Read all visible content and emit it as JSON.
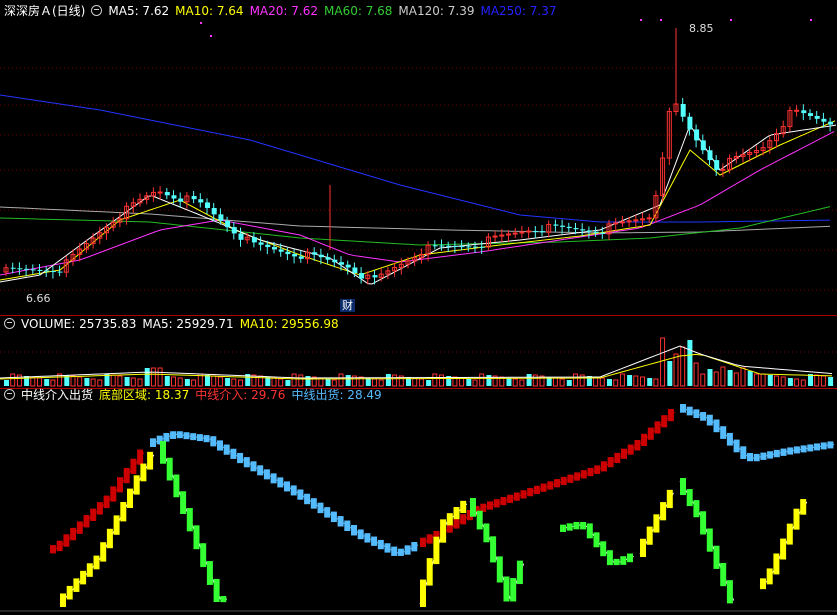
{
  "price_panel": {
    "title": "深深房Ａ(日线)",
    "ma": [
      {
        "label": "MA5: 7.62",
        "color": "#ffffff"
      },
      {
        "label": "MA10: 7.64",
        "color": "#ffff00"
      },
      {
        "label": "MA20: 7.62",
        "color": "#ff33ff"
      },
      {
        "label": "MA60: 7.68",
        "color": "#33cc33"
      },
      {
        "label": "MA120: 7.39",
        "color": "#cccccc"
      },
      {
        "label": "MA250: 7.37",
        "color": "#2222ff"
      }
    ],
    "high_label": "8.85",
    "low_label": "6.66",
    "event_badge": "财"
  },
  "volume_panel": {
    "items": [
      {
        "label": "VOLUME: 25735.83",
        "color": "#ffffff"
      },
      {
        "label": "MA5: 25929.71",
        "color": "#ffffff"
      },
      {
        "label": "MA10: 29556.98",
        "color": "#ffff00"
      }
    ]
  },
  "indicator_panel": {
    "items": [
      {
        "label": "中线介入出货",
        "color": "#ffffff"
      },
      {
        "label": "底部区域: 18.37",
        "color": "#ffff00"
      },
      {
        "label": "中线介入: 29.76",
        "color": "#ff3333"
      },
      {
        "label": "中线出货: 28.49",
        "color": "#55bbff"
      }
    ]
  },
  "colors": {
    "up": "#ff3232",
    "down": "#54ffff",
    "grid": "#7a0000"
  },
  "chart_data": {
    "type": "candlestick",
    "high": 8.85,
    "low": 6.66
  }
}
